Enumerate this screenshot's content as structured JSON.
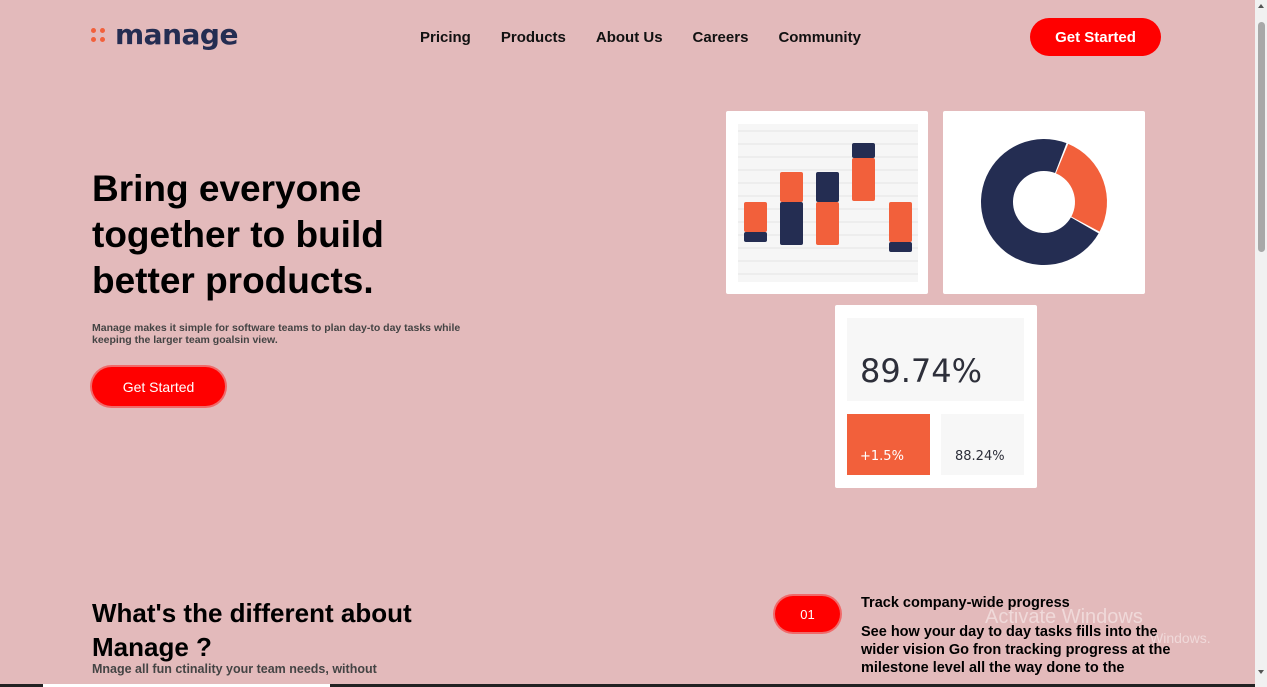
{
  "header": {
    "logo_text": "manage",
    "nav": [
      "Pricing",
      "Products",
      "About Us",
      "Careers",
      "Community"
    ],
    "cta_label": "Get Started"
  },
  "hero": {
    "title": "Bring everyone together to build better products.",
    "subtitle": "Manage makes it simple for software teams to plan day-to day tasks while keeping the larger team goalsin view.",
    "cta_label": "Get Started"
  },
  "stats": {
    "main_value": "89.74%",
    "change_value": "+1.5%",
    "secondary_value": "88.24%"
  },
  "chart_data": [
    {
      "type": "bar",
      "description_series_colors": [
        "#f2603b",
        "#242d52"
      ],
      "bars": [
        {
          "orange": 30,
          "navy": 10
        },
        {
          "orange": 30,
          "navy": 43
        },
        {
          "orange": 43,
          "navy": 30
        },
        {
          "orange": 43,
          "navy": 15
        },
        {
          "orange": 40,
          "navy": 10
        }
      ]
    },
    {
      "type": "pie",
      "slices": [
        {
          "color": "#f2603b",
          "value": 27
        },
        {
          "color": "#242d52",
          "value": 73
        }
      ]
    }
  ],
  "features": {
    "title": "What's the different about Manage ?",
    "subtitle": "Mnage all fun ctinality your team needs, without",
    "items": [
      {
        "number": "01",
        "title": "Track company-wide progress",
        "desc": "See how your day to day tasks fills into the wider vision Go fron tracking progress at the milestone level all the way done to the"
      }
    ]
  },
  "watermark": {
    "line1": "Activate Windows",
    "line2": "Windows."
  },
  "colors": {
    "background": "#e3babb",
    "accent_red": "#ff0000",
    "orange": "#f2603b",
    "navy": "#242d52"
  }
}
